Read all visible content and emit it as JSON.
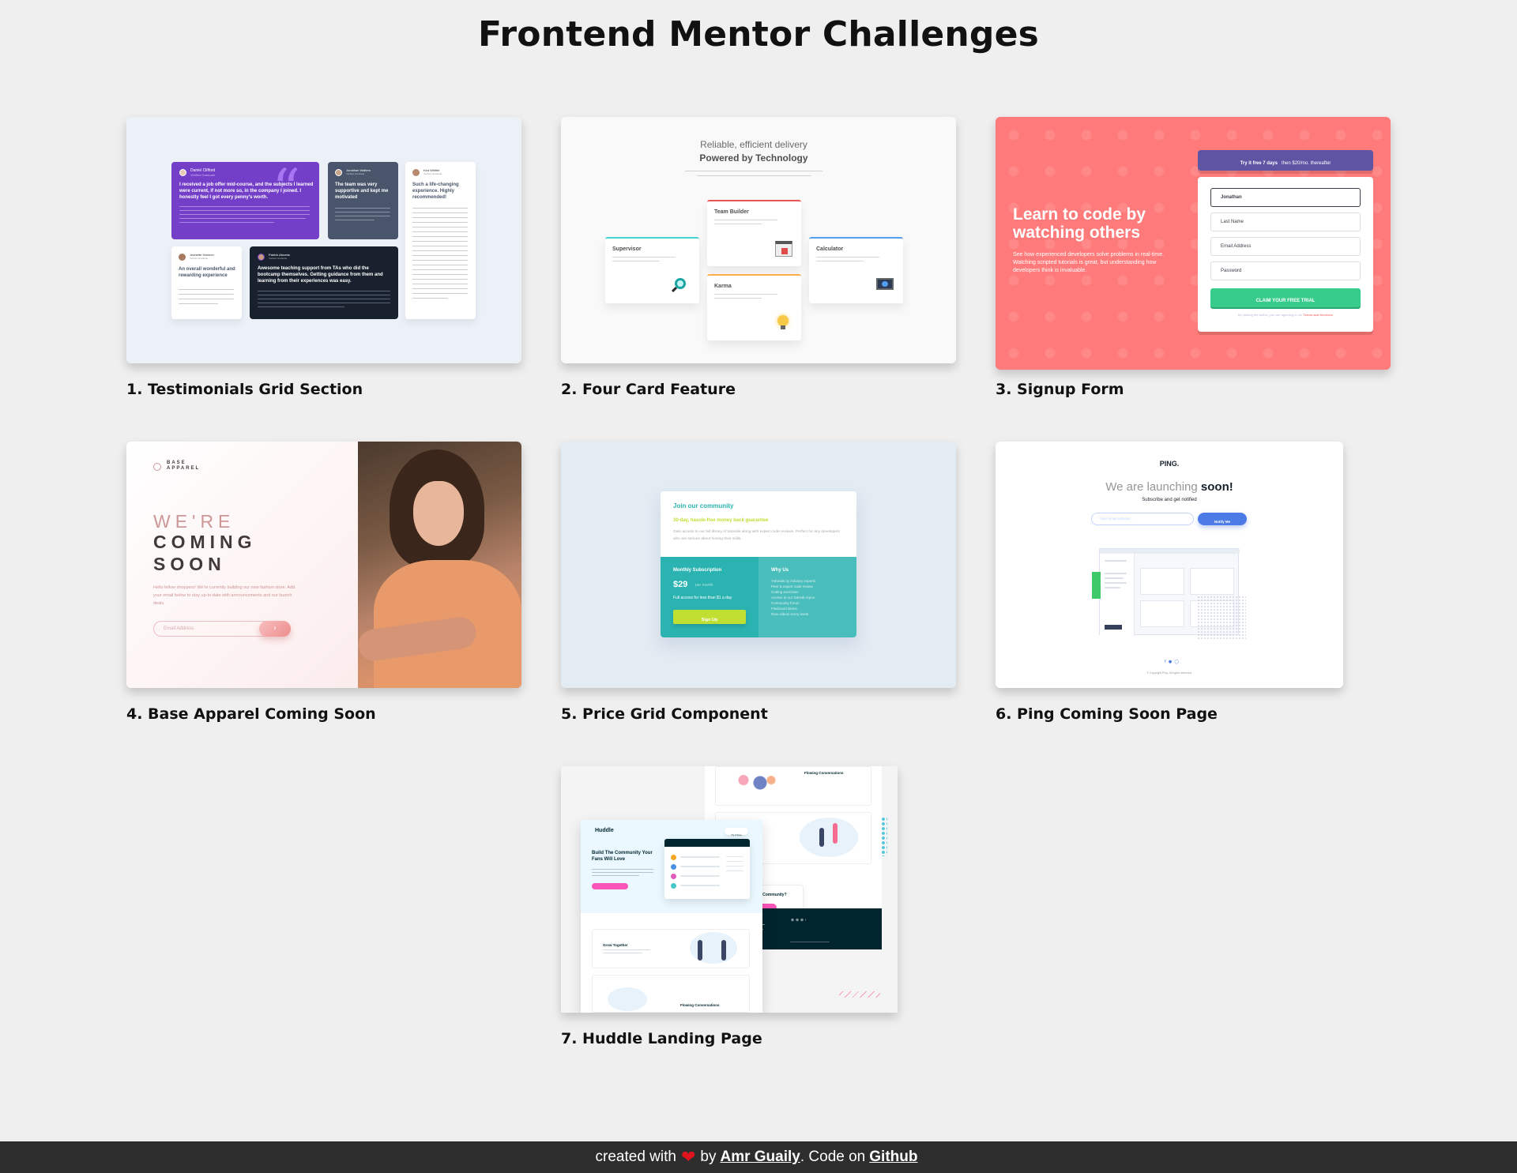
{
  "page": {
    "title": "Frontend Mentor Challenges"
  },
  "projects": [
    {
      "title": "1. Testimonials Grid Section",
      "preview": {
        "t1_name": "Daniel Clifford",
        "t1_role": "Verified Graduate",
        "t1_headline": "I received a job offer mid-course, and the subjects I learned were current, if not more so, in the company I joined. I honestly feel I got every penny's worth.",
        "t2_name": "Jonathan Walters",
        "t2_role": "Verified Graduate",
        "t2_headline": "The team was very supportive and kept me motivated",
        "t3_name": "Kira Whittle",
        "t3_role": "Verified Graduate",
        "t3_headline": "Such a life-changing experience. Highly recommended!",
        "t4_name": "Jeanette Harmon",
        "t4_role": "Verified Graduate",
        "t4_headline": "An overall wonderful and rewarding experience",
        "t5_name": "Patrick Abrams",
        "t5_role": "Verified Graduate",
        "t5_headline": "Awesome teaching support from TAs who did the bootcamp themselves. Getting guidance from them and learning from their experiences was easy."
      }
    },
    {
      "title": "2. Four Card Feature",
      "preview": {
        "heading_light": "Reliable, efficient delivery",
        "heading_bold": "Powered by Technology",
        "c1": "Supervisor",
        "c2": "Team Builder",
        "c3": "Karma",
        "c4": "Calculator"
      }
    },
    {
      "title": "3. Signup Form",
      "preview": {
        "headline": "Learn to code by watching others",
        "subtext": "See how experienced developers solve problems in real-time. Watching scripted tutorials is great, but understanding how developers think is invaluable.",
        "banner_bold": "Try it free 7 days",
        "banner_rest": "then $20/mo. thereafter",
        "field1_value": "Jonathan",
        "field2_placeholder": "Last Name",
        "field3_placeholder": "Email Address",
        "field4_placeholder": "Password",
        "cta": "CLAIM YOUR FREE TRIAL",
        "terms": "By clicking the button, you are agreeing to our",
        "terms_link": "Terms and Services"
      }
    },
    {
      "title": "4. Base Apparel Coming Soon",
      "preview": {
        "logo_line1": "BASE",
        "logo_line2": "APPAREL",
        "heading_light": "WE'RE",
        "heading_bold1": "COMING",
        "heading_bold2": "SOON",
        "paragraph": "Hello fellow shoppers! We're currently building our new fashion store. Add your email below to stay up-to-date with announcements and our launch deals.",
        "input_placeholder": "Email Address"
      }
    },
    {
      "title": "5. Price Grid Component",
      "preview": {
        "heading": "Join our community",
        "guarantee": "30-day, hassle-free money back guarantee",
        "description": "Gain access to our full library of tutorials along with expert code reviews. Perfect for any developers who are serious about honing their skills.",
        "sub_title": "Monthly Subscription",
        "price": "$29",
        "per": "per month",
        "sub_text": "Full access for less than $1 a day",
        "button": "Sign Up",
        "why_title": "Why Us",
        "why_items": [
          "Tutorials by industry experts",
          "Peer & expert code review",
          "Coding exercises",
          "Access to our GitHub repos",
          "Community forum",
          "Flashcard decks",
          "New videos every week"
        ]
      }
    },
    {
      "title": "6. Ping Coming Soon Page",
      "preview": {
        "logo": "PING.",
        "heading_light": "We are launching",
        "heading_bold": "soon!",
        "subscribe": "Subscribe and get notified",
        "input_placeholder": "Your email address...",
        "button": "Notify Me",
        "copyright": "© Copyright Ping. All rights reserved."
      }
    },
    {
      "title": "7. Huddle Landing Page",
      "preview": {
        "logo": "Huddle",
        "try_it": "Try It Free",
        "hero": "Build The Community Your Fans Will Love",
        "grow": "Grow Together",
        "flowing": "Flowing Conversations",
        "ready": "Ready To Build Your Community?",
        "get_started": "Get Started For Free"
      }
    }
  ],
  "footer": {
    "created_with": "created with",
    "by": "by",
    "author": "Amr Guaily",
    "code_on": ". Code on",
    "github": "Github"
  },
  "colors": {
    "background": "#efefef",
    "footer": "#2d2d2d",
    "heart": "#e0141e",
    "testimonial_purple": "#733fc8",
    "signup_red": "#ff7a7a",
    "signup_purple": "#5e54a4",
    "signup_green": "#38cc8c",
    "price_teal": "#2bb3b1",
    "price_lime": "#bfdf32",
    "ping_blue": "#4c7be8",
    "huddle_pink": "#fa55bb",
    "huddle_dark": "#00252e"
  },
  "icons": [
    "heart-icon",
    "magnifier-icon",
    "chart-icon",
    "lightbulb-icon",
    "monitor-icon",
    "arrow-right-icon",
    "avatar-icon",
    "quote-icon"
  ]
}
